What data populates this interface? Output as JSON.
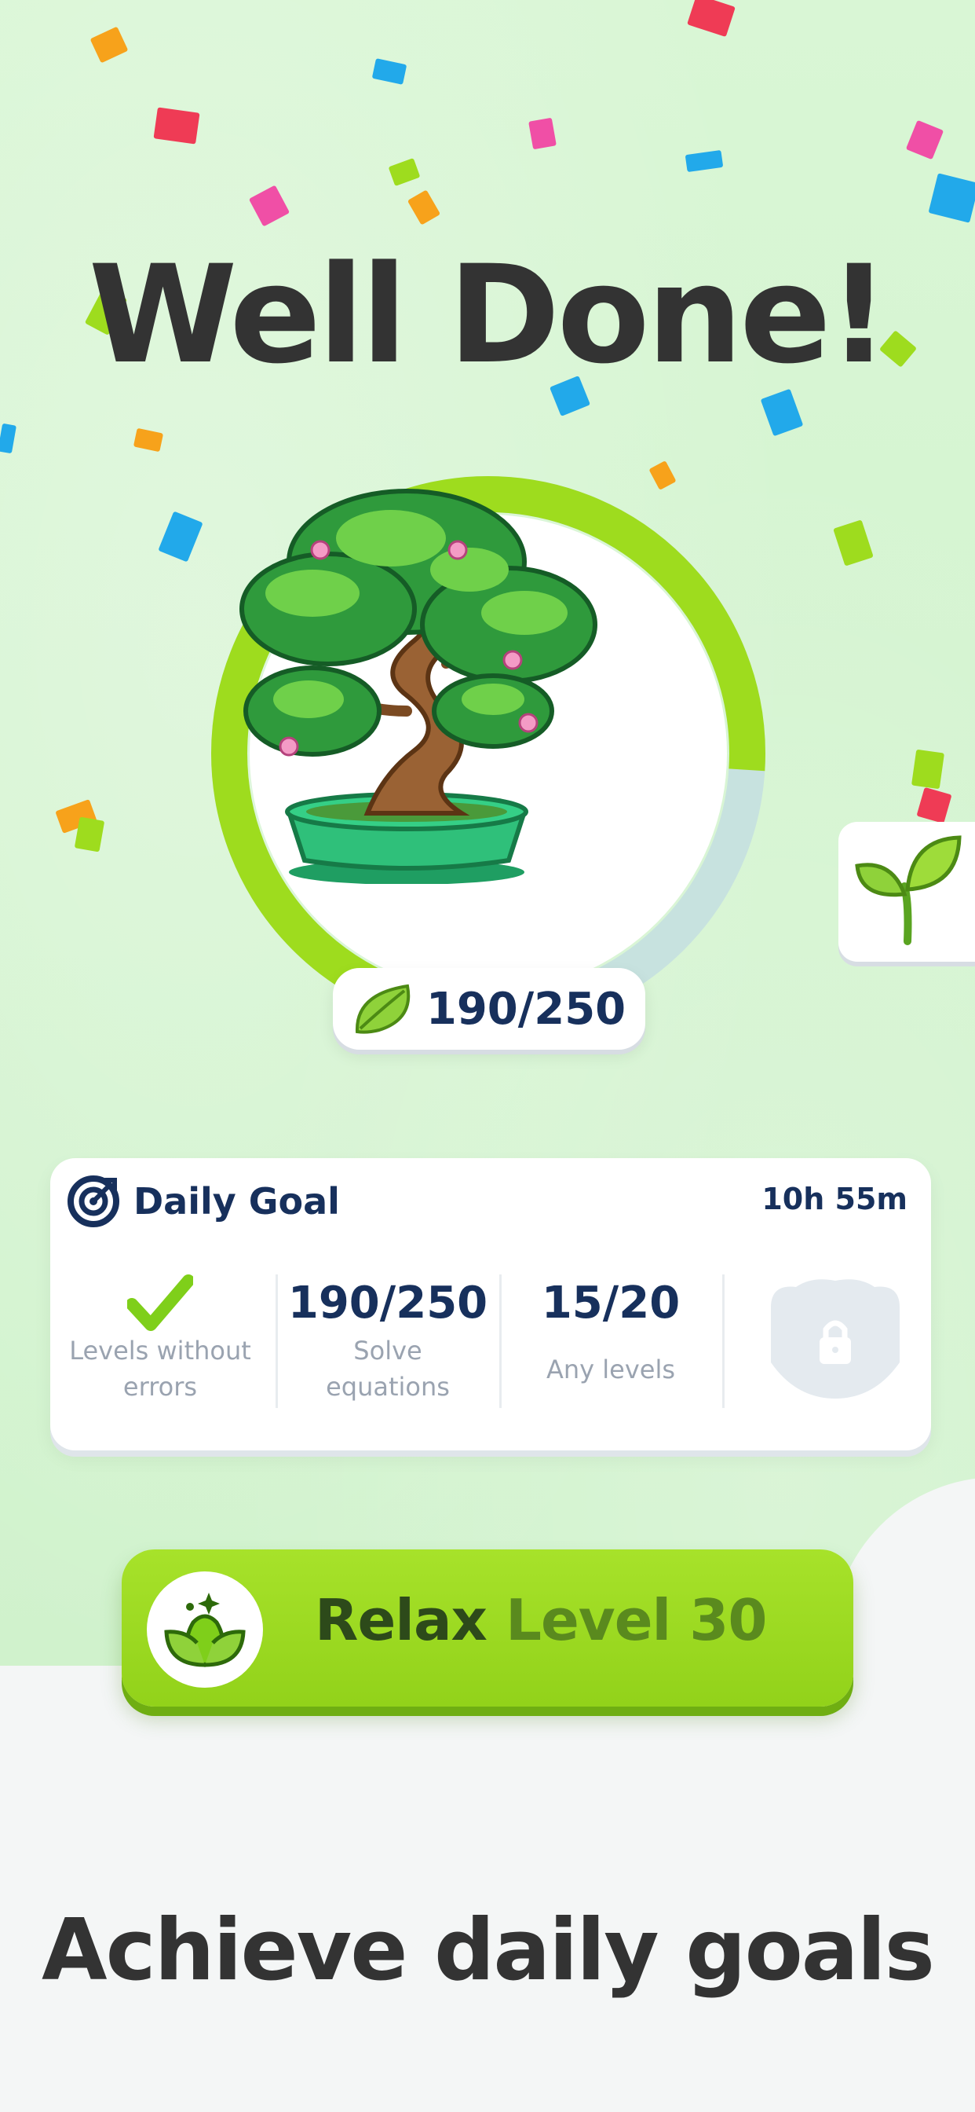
{
  "headline": "Well Done!",
  "progress": {
    "current": 190,
    "total": 250,
    "label": "190/250",
    "fraction": 0.76,
    "ring_color": "#9edc1e",
    "track_color": "#c7e2df"
  },
  "daily_goal": {
    "title": "Daily Goal",
    "timer": "10h 55m",
    "tasks": [
      {
        "status": "completed",
        "label_line1": "Levels without",
        "label_line2": "errors"
      },
      {
        "value": "190/250",
        "label_line1": "Solve",
        "label_line2": "equations"
      },
      {
        "value": "15/20",
        "label_line1": "Any levels"
      },
      {
        "status": "locked",
        "icon": "lock-chest-icon"
      }
    ]
  },
  "relax_button": {
    "word": "Relax",
    "level": "Level 30",
    "color": "#9edc1e"
  },
  "tagline": "Achieve daily goals",
  "colors": {
    "background": "#d6f5d2",
    "text_dark": "#333333",
    "navy": "#17305c",
    "muted": "#9aa3b0"
  }
}
